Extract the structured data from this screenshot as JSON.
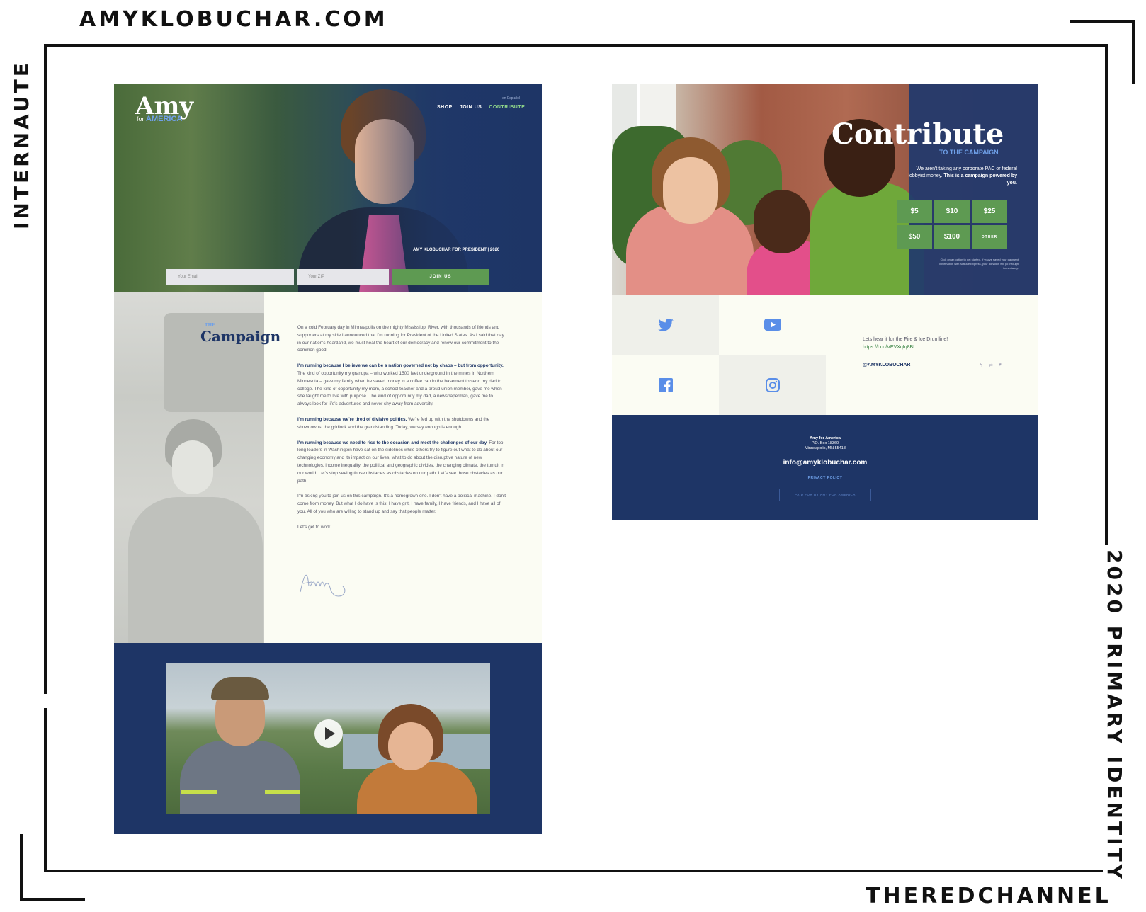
{
  "frame": {
    "top_label": "AMYKLOBUCHAR.COM",
    "left_label": "INTERNAUTE",
    "right_label": "2020 PRIMARY IDENTITY",
    "bottom_label": "THEREDCHANNEL"
  },
  "hero": {
    "logo_main": "Amy",
    "logo_for": "for",
    "logo_america": "AMERICA",
    "espanol": "en Español",
    "nav": [
      "SHOP",
      "JOIN US",
      "CONTRIBUTE"
    ],
    "tagline": "AMY KLOBUCHAR FOR PRESIDENT  |  2020",
    "email_placeholder": "Your Email",
    "zip_placeholder": "Your ZIP",
    "join_label": "JOIN US"
  },
  "campaign": {
    "kicker": "THE",
    "title": "Campaign",
    "p1": "On a cold February day in Minneapolis on the mighty Mississippi River, with thousands of friends and supporters at my side I announced that I'm running for President of the United States. As I said that day in our nation's heartland, we must heal the heart of our democracy and renew our commitment to the common good.",
    "p2_bold": "I'm running because I believe we can be a nation governed not by chaos – but from opportunity.",
    "p2": " The kind of opportunity my grandpa – who worked 1500 feet underground in the mines in Northern Minnesota – gave my family when he saved money in a coffee can in the basement to send my dad to college. The kind of opportunity my mom, a school teacher and a proud union member, gave me when she taught me to live with purpose. The kind of opportunity my dad, a newspaperman, gave me to always look for life's adventures and never shy away from adversity.",
    "p3_bold": "I'm running because we're tired of divisive politics.",
    "p3": " We're fed up with the shutdowns and the showdowns, the gridlock and the grandstanding. Today, we say enough is enough.",
    "p4_bold": "I'm running because we need to rise to the occasion and meet the challenges of our day.",
    "p4": " For too long leaders in Washington have sat on the sidelines while others try to figure out what to do about our changing economy and its impact on our lives, what to do about the disruptive nature of new technologies, income inequality, the political and geographic divides, the changing climate, the tumult in our world. Let's stop seeing those obstacles as obstacles on our path. Let's see those obstacles as our path.",
    "p5": "I'm asking you to join us on this campaign. It's a homegrown one. I don't have a political machine. I don't come from money. But what I do have is this: I have grit, I have family, I have friends, and I have all of you. All of you who are willing to stand up and say that people matter.",
    "p6": "Let's get to work."
  },
  "contribute": {
    "title": "Contribute",
    "subtitle": "TO THE CAMPAIGN",
    "desc": "We aren't taking any corporate PAC or federal lobbyist money.",
    "desc_bold": "This is a campaign powered by you.",
    "amounts": [
      "$5",
      "$10",
      "$25",
      "$50",
      "$100",
      "OTHER"
    ],
    "note": "Click on an option to get started. If you've saved your payment information with ActBlue Express, your donation will go through immediately."
  },
  "social": {
    "tweet_text": "Lets hear it for the Fire & Ice Drumline!",
    "tweet_link": "https://t.co/VEVXqIq8BL",
    "handle": "@AMYKLOBUCHAR"
  },
  "footer": {
    "org": "Amy for America",
    "po": "P.O. Box 18360",
    "city": "Minneapolis, MN 55418",
    "email": "info@amyklobuchar.com",
    "privacy": "PRIVACY POLICY",
    "paid": "PAID FOR BY AMY FOR AMERICA"
  },
  "colors": {
    "navy": "#1e3566",
    "green": "#5e9a52",
    "accent_blue": "#6fa0e8",
    "cream": "#fbfcf3"
  }
}
